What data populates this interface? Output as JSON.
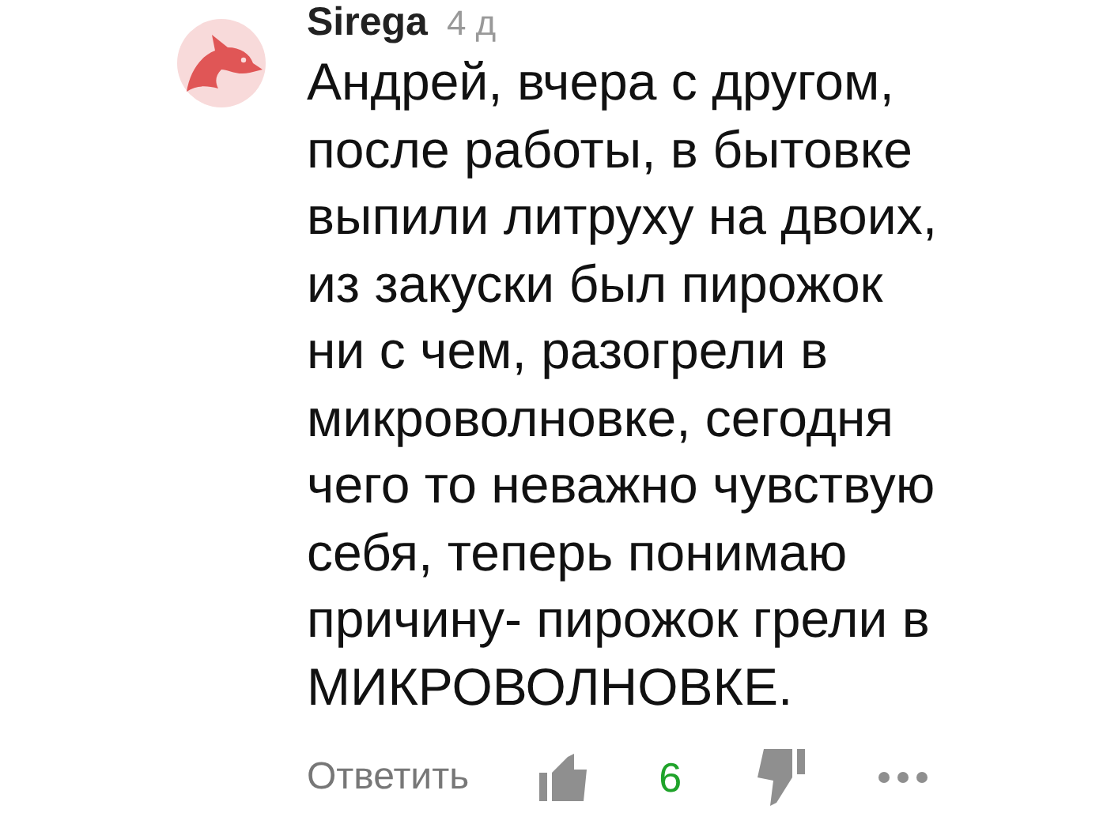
{
  "comment": {
    "author": "Sirega",
    "time": "4 д",
    "text": "Андрей, вчера с другом,\nпосле работы, в бытовке\nвыпили литруху на двоих,\nиз закуски был пирожок\nни с чем, разогрели в\nмикроволновке, сегодня\nчего то неважно чувствую\nсебя, теперь понимаю\nпричину- пирожок грели в\nМИКРОВОЛНОВКЕ.",
    "reply": "Ответить",
    "score": "6"
  }
}
